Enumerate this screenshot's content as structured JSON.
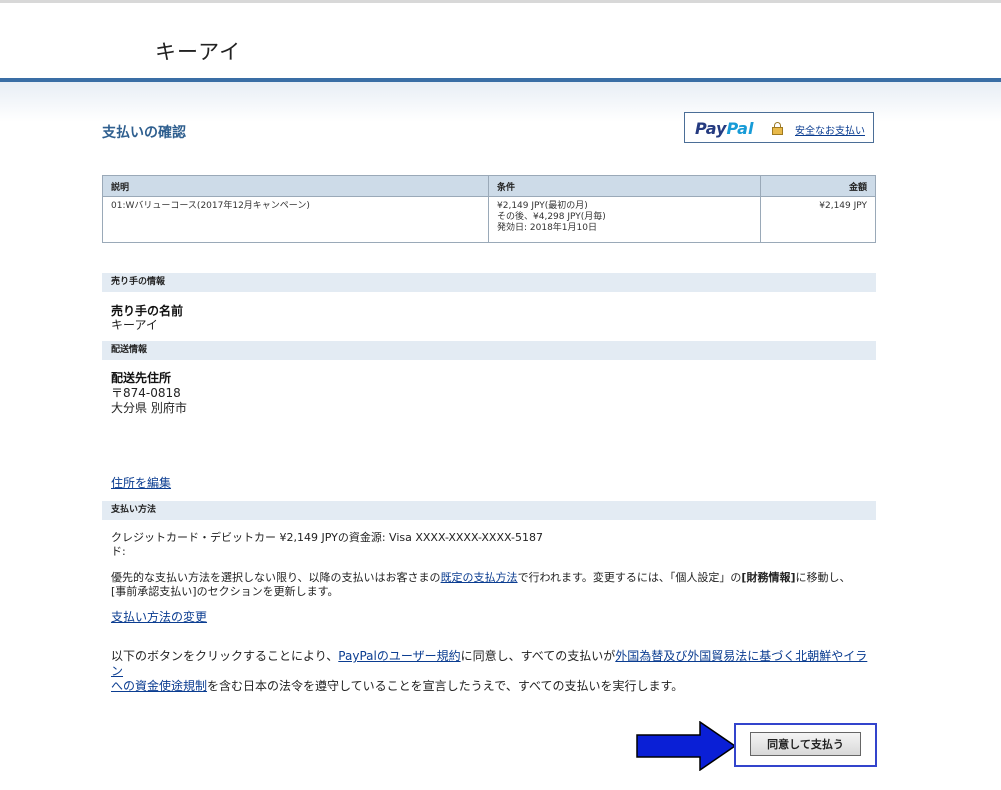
{
  "header": {
    "merchant_name": "キーアイ"
  },
  "page": {
    "title": "支払いの確認"
  },
  "paypal_badge": {
    "logo_part1": "Pay",
    "logo_part2": "Pal",
    "secure_link": "安全なお支払い"
  },
  "items_table": {
    "headers": [
      "説明",
      "条件",
      "金額"
    ],
    "rows": [
      {
        "description": "01:Wバリューコース(2017年12月キャンペーン)",
        "terms": [
          "¥2,149 JPY(最初の月)",
          "その後、¥4,298 JPY(月毎)",
          "発効日: 2018年1月10日"
        ],
        "amount": "¥2,149 JPY"
      }
    ]
  },
  "seller": {
    "section_title": "売り手の情報",
    "name_label": "売り手の名前",
    "name_value": "キーアイ"
  },
  "shipping": {
    "section_title": "配送情報",
    "address_label": "配送先住所",
    "postal": "〒874-0818",
    "city": "大分県 別府市",
    "edit_link": "住所を編集"
  },
  "payment": {
    "section_title": "支払い方法",
    "source_text_line1": "クレジットカード・デビットカー  ¥2,149 JPYの資金源: Visa XXXX-XXXX-XXXX-5187",
    "source_text_line2": "ド:",
    "notice_part1": "優先的な支払い方法を選択しない限り、以降の支払いはお客さまの",
    "notice_link": "既定の支払方法",
    "notice_part2": "で行われます。変更するには、「個人設定」の",
    "notice_bold": "[財務情報]",
    "notice_part3": "に移動し、",
    "notice_line2": "[事前承認支払い]のセクションを更新します。",
    "change_link": "支払い方法の変更"
  },
  "agreement": {
    "part1": "以下のボタンをクリックすることにより、",
    "link1": "PayPalのユーザー規約",
    "part2": "に同意し、すべての支払いが",
    "link2a": "外国為替及び外国貿易法に基づく北朝鮮やイラン",
    "link2b": "への資金使途規制",
    "part3": "を含む日本の法令を遵守していることを宣言したうえで、すべての支払いを実行します。"
  },
  "actions": {
    "agree_button": "同意して支払う"
  },
  "colors": {
    "accent_blue": "#3a6ea5",
    "title_blue": "#2f5f8f",
    "link_blue": "#0b3d91",
    "table_header_bg": "#cddbe8",
    "section_bg": "#e3ebf3",
    "arrow_blue": "#0a1fd6",
    "highlight_frame": "#3344cc"
  }
}
